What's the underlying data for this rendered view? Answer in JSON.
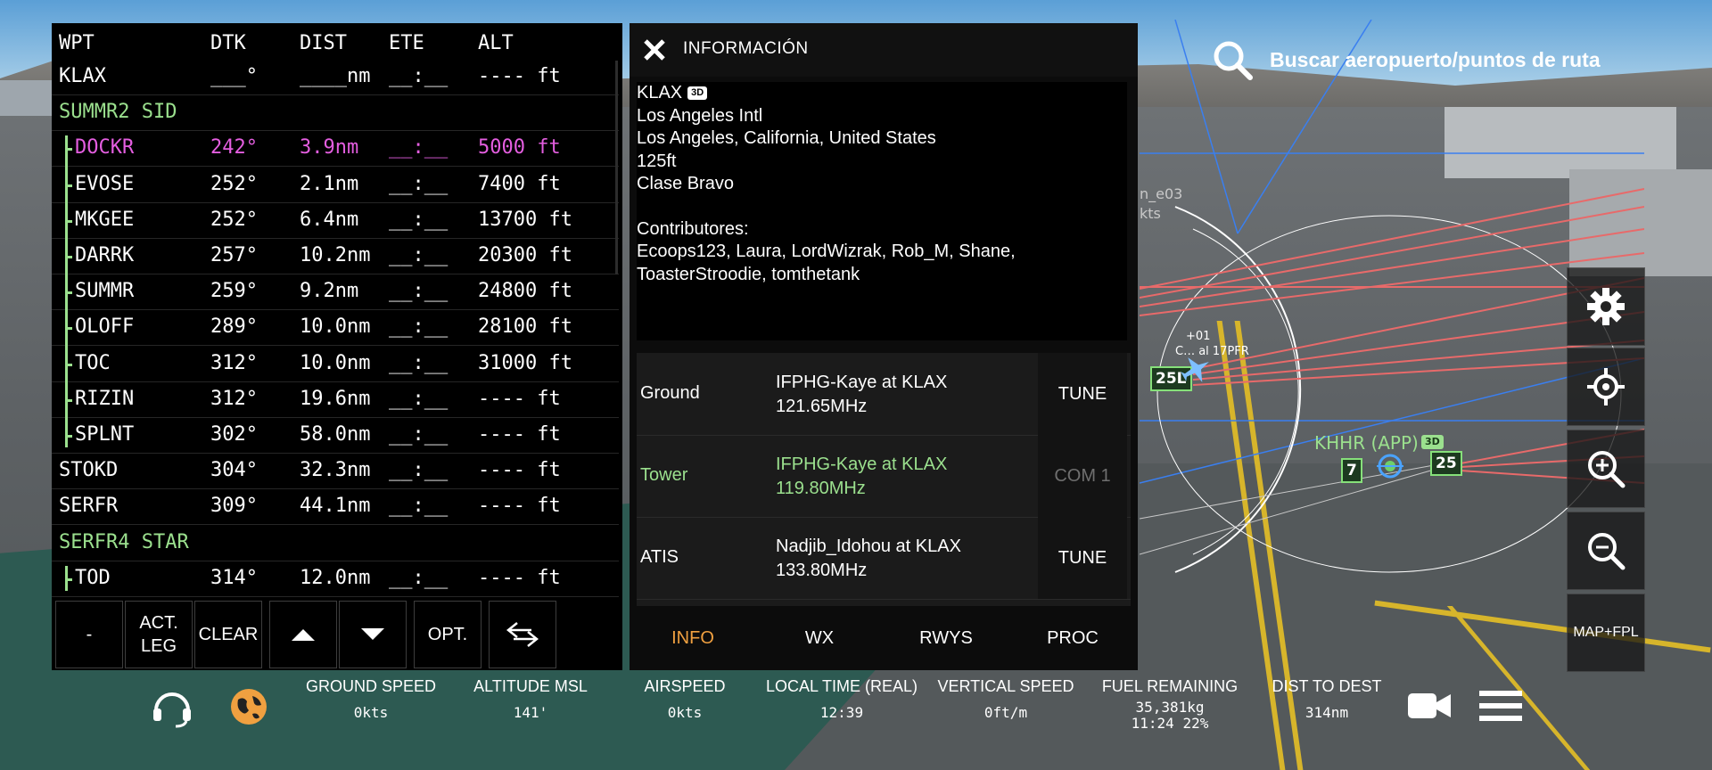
{
  "flight_plan": {
    "headers": {
      "wpt": "WPT",
      "dtk": "DTK",
      "dist": "DIST",
      "ete": "ETE",
      "alt": "ALT"
    },
    "origin": {
      "wpt": "KLAX",
      "dtk": "___°",
      "dist": "____nm",
      "ete": "__:__",
      "alt": "---- ft"
    },
    "sid_name": "SUMMR2 SID",
    "sid_legs": [
      {
        "wpt": "DOCKR",
        "dtk": "242°",
        "dist": "3.9nm",
        "ete": "__:__",
        "alt": "5000 ft",
        "active": true
      },
      {
        "wpt": "EVOSE",
        "dtk": "252°",
        "dist": "2.1nm",
        "ete": "__:__",
        "alt": "7400 ft"
      },
      {
        "wpt": "MKGEE",
        "dtk": "252°",
        "dist": "6.4nm",
        "ete": "__:__",
        "alt": "13700 ft"
      },
      {
        "wpt": "DARRK",
        "dtk": "257°",
        "dist": "10.2nm",
        "ete": "__:__",
        "alt": "20300 ft"
      },
      {
        "wpt": "SUMMR",
        "dtk": "259°",
        "dist": "9.2nm",
        "ete": "__:__",
        "alt": "24800 ft"
      },
      {
        "wpt": "OLOFF",
        "dtk": "289°",
        "dist": "10.0nm",
        "ete": "__:__",
        "alt": "28100 ft"
      },
      {
        "wpt": "TOC",
        "dtk": "312°",
        "dist": "10.0nm",
        "ete": "__:__",
        "alt": "31000 ft"
      },
      {
        "wpt": "RIZIN",
        "dtk": "312°",
        "dist": "19.6nm",
        "ete": "__:__",
        "alt": "---- ft"
      },
      {
        "wpt": "SPLNT",
        "dtk": "302°",
        "dist": "58.0nm",
        "ete": "__:__",
        "alt": "---- ft"
      }
    ],
    "enroute": [
      {
        "wpt": "STOKD",
        "dtk": "304°",
        "dist": "32.3nm",
        "ete": "__:__",
        "alt": "---- ft"
      },
      {
        "wpt": "SERFR",
        "dtk": "309°",
        "dist": "44.1nm",
        "ete": "__:__",
        "alt": "---- ft"
      }
    ],
    "star_name": "SERFR4 STAR",
    "star_legs": [
      {
        "wpt": "TOD",
        "dtk": "314°",
        "dist": "12.0nm",
        "ete": "__:__",
        "alt": "---- ft"
      }
    ],
    "toolbar": {
      "dash": "-",
      "act_leg": "ACT.\nLEG",
      "clear": "CLEAR",
      "opt": "OPT."
    }
  },
  "info": {
    "header_title": "INFORMACIÓN",
    "icao": "KLAX",
    "badge_3d": "3D",
    "name": "Los Angeles Intl",
    "location": "Los Angeles, California, United States",
    "elevation": "125ft",
    "airspace_class": "Clase Bravo",
    "contributors_label": "Contributores:",
    "contributors": "Ecoops123, Laura, LordWizrak, Rob_M, Shane, ToasterStroodie, tomthetank",
    "frequencies": [
      {
        "type": "Ground",
        "controller": "IFPHG-Kaye at KLAX",
        "freq": "121.65MHz",
        "action": "TUNE",
        "active": false
      },
      {
        "type": "Tower",
        "controller": "IFPHG-Kaye at KLAX",
        "freq": "119.80MHz",
        "action": "COM 1",
        "active": true
      },
      {
        "type": "ATIS",
        "controller": "Nadjib_Idohou at KLAX",
        "freq": "133.80MHz",
        "action": "TUNE",
        "active": false
      }
    ],
    "tabs": [
      {
        "label": "INFO",
        "active": true
      },
      {
        "label": "WX"
      },
      {
        "label": "RWYS"
      },
      {
        "label": "PROC"
      }
    ]
  },
  "search": {
    "label": "Buscar aeropuerto/puntos de ruta"
  },
  "map": {
    "airport_label": "KHHR (APP)",
    "airport_badge": "3D",
    "rwy_left": "7",
    "rwy_right": "25",
    "own_rwy": "25L",
    "callsign_fragment": "+01",
    "traffic_label": "C… al 17PFR",
    "ghost_label1": "n_e03",
    "ghost_label2": "kts",
    "map_fpl_label": "MAP+FPL"
  },
  "status": {
    "ground_speed": {
      "label": "GROUND SPEED",
      "value": "0kts"
    },
    "altitude_msl": {
      "label": "ALTITUDE MSL",
      "value": "141'"
    },
    "airspeed": {
      "label": "AIRSPEED",
      "value": "0kts"
    },
    "local_time": {
      "label": "LOCAL TIME (REAL)",
      "value": "12:39"
    },
    "vertical_speed": {
      "label": "VERTICAL SPEED",
      "value": "0ft/m"
    },
    "fuel_remaining": {
      "label": "FUEL REMAINING",
      "value1": "35,381kg",
      "value2": "11:24 22%"
    },
    "dist_to_dest": {
      "label": "DIST TO DEST",
      "value": "314nm"
    }
  },
  "colors": {
    "accent_orange": "#f0a040",
    "active_green": "#9be08e",
    "active_leg_magenta": "#e45ee0",
    "route_red": "#e86a6a"
  }
}
